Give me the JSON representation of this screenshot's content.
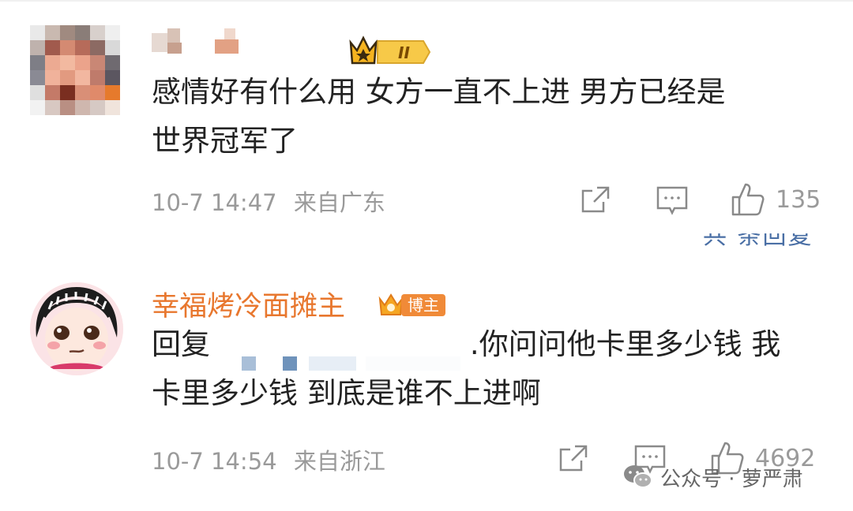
{
  "comments": [
    {
      "username": "",
      "text_lines": [
        "感情好有什么用 女方一直不上进 男方已经是",
        "世界冠军了"
      ],
      "time": "10-7 14:47",
      "location": "来自广东",
      "likes": "135",
      "badge_level": "II"
    },
    {
      "username": "幸福烤冷面摊主",
      "badge_label": "博主",
      "reply_prefix": "回复",
      "reply_rest": ".你问问他卡里多少钱 我",
      "text_line2": "卡里多少钱 到底是谁不上进啊",
      "time": "10-7 14:54",
      "location": "来自浙江",
      "likes": "4692"
    }
  ],
  "partial_text": "共 条回复",
  "watermark": "公众号 · 萝严肃",
  "icons": [
    "share-icon",
    "comment-icon",
    "like-icon",
    "crown-icon",
    "wechat-icon"
  ],
  "colors": {
    "username_orange": "#e8772e",
    "meta_gray": "#9a9a9a",
    "badge_gold": "#f5a623"
  }
}
